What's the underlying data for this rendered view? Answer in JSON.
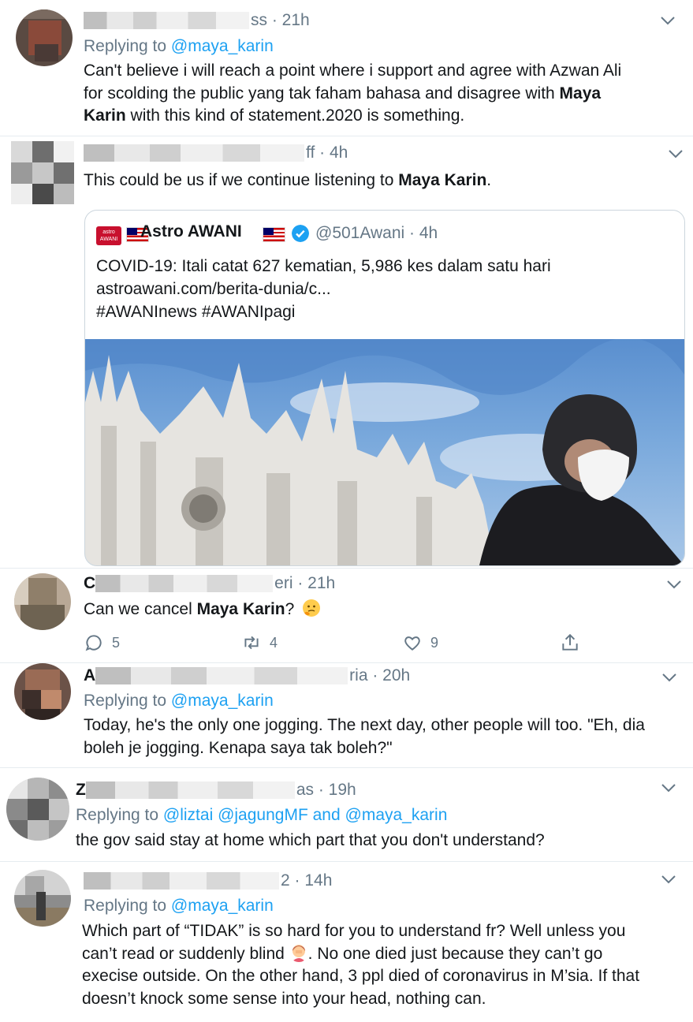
{
  "tweets": [
    {
      "name_suffix": "ss",
      "time": "· 21h",
      "replying_prefix": "Replying to",
      "replying_to": "@maya_karin",
      "body_lines": [
        "Can't believe i will reach a point where i support and agree with Azwan Ali",
        "for scolding the public yang tak faham bahasa and disagree with ",
        "Maya",
        "Karin",
        " with this kind of statement.2020 is something."
      ]
    },
    {
      "name_suffix": "ff",
      "time": "· 4h",
      "body_pre": "This could be us if we continue listening to ",
      "body_bold": "Maya Karin",
      "body_post": ".",
      "quote": {
        "logo_line1": "astro",
        "logo_line2": "AWANI",
        "name": "Astro AWANI",
        "handle": "@501Awani · 4h",
        "lines": [
          "COVID-19: Itali catat 627 kematian, 5,986 kes dalam satu hari",
          "astroawani.com/berita-dunia/c...",
          "#AWANInews #AWANIpagi"
        ]
      }
    },
    {
      "name_prefix": "C",
      "name_suffix": "eri",
      "time": "· 21h",
      "body_pre": "Can we cancel ",
      "body_bold": "Maya Karin",
      "body_post": "?",
      "emoji": "thinking-face",
      "actions": {
        "replies": "5",
        "retweets": "4",
        "likes": "9"
      }
    },
    {
      "name_prefix": "A",
      "name_suffix": "ria",
      "time": "· 20h",
      "replying_prefix": "Replying to",
      "replying_to": "@maya_karin",
      "body_lines": [
        "Today, he's the only one jogging. The next day, other people will too. \"Eh, dia",
        "boleh je jogging. Kenapa saya tak boleh?\""
      ]
    },
    {
      "name_prefix": "Z",
      "name_suffix": "as",
      "time": "· 19h",
      "replying_prefix": "Replying to",
      "replying_mention_1": "@liztai",
      "replying_mention_2": "@jagungMF",
      "replying_and": "and",
      "replying_mention_3": "@maya_karin",
      "body_lines": [
        "the gov said stay at home which part that you don't understand?"
      ]
    },
    {
      "name_suffix": "2",
      "time": "· 14h",
      "replying_prefix": "Replying to",
      "replying_to": "@maya_karin",
      "body_lines": [
        "Which part of “TIDAK” is so hard for you to understand fr? Well unless you",
        "can’t read or suddenly blind ",
        ". No one died just because they can’t go",
        "execise outside. On the other hand, 3 ppl died of coronavirus in M’sia. If that",
        "doesn’t knock some sense into your head, nothing can."
      ],
      "emoji": "person-facepalming"
    }
  ],
  "colors": {
    "link": "#1da1f2",
    "muted": "#657786",
    "text": "#14171a",
    "divider": "#e6ecf0"
  }
}
